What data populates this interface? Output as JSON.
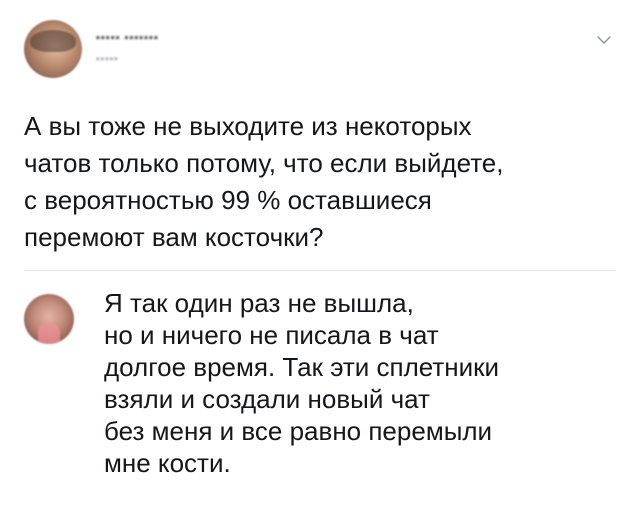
{
  "tweet": {
    "author_name": "▪▪▪▪▪ ▪▪▪▪▪▪▪",
    "author_handle": "▪▪▪▪▪",
    "menu_icon": "chevron-down-icon",
    "text_lines": [
      "А вы тоже не выходите из некоторых",
      "чатов только потому, что если выйдете,",
      "с вероятностью 99 % оставшиеся",
      "перемоют вам косточки?"
    ]
  },
  "reply": {
    "text_lines": [
      "Я так один раз не вышла,",
      "но и ничего не писала в чат",
      "долгое время. Так эти сплетники",
      "взяли и создали новый чат",
      "без меня и все равно перемыли",
      "мне кости."
    ]
  },
  "colors": {
    "text": "#14171a",
    "divider": "#e1e8ed",
    "chevron": "#8899a6",
    "background": "#ffffff"
  }
}
